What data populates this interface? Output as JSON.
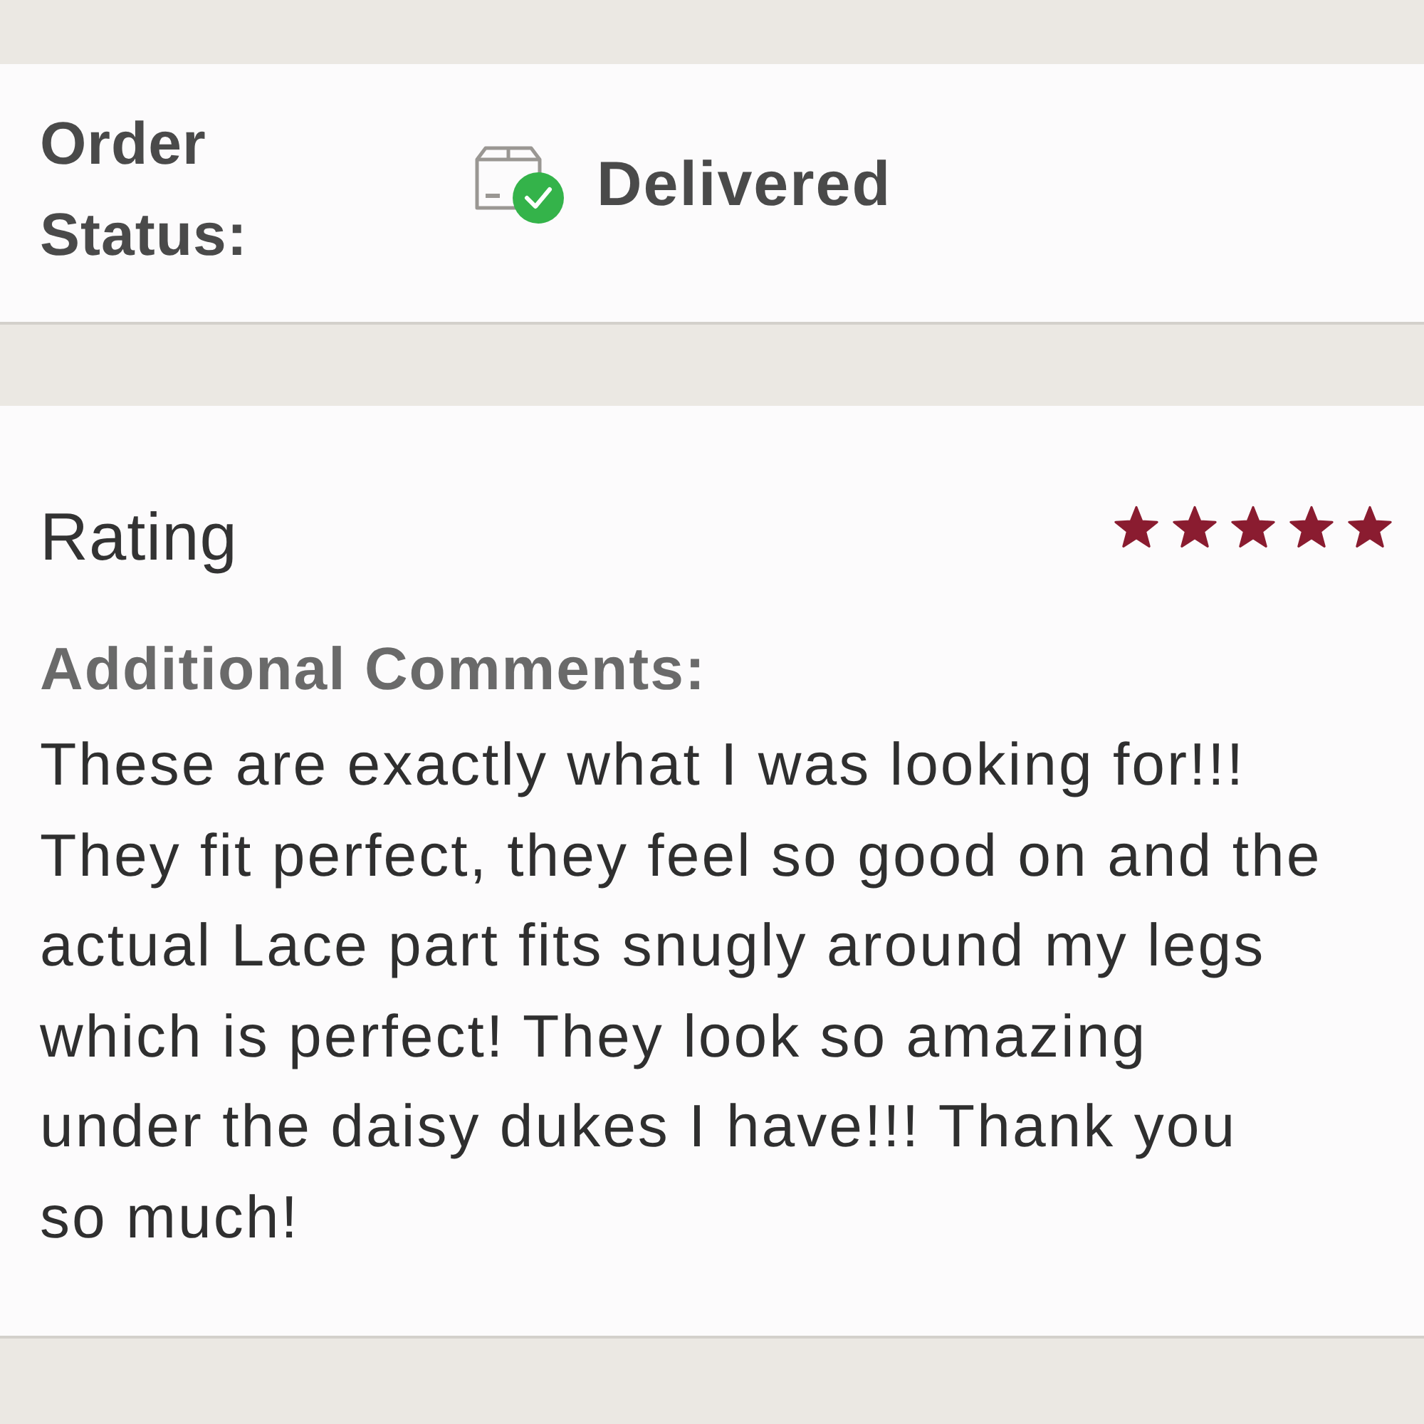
{
  "order_status": {
    "label": "Order Status:",
    "value": "Delivered"
  },
  "review": {
    "rating_label": "Rating",
    "stars": 5,
    "comments_label": "Additional Comments:",
    "comment": "These are exactly what I was looking for!!! They fit perfect, they feel so good on and the actual Lace part fits snugly around my legs which is perfect! They look so amazing under the daisy dukes I have!!! Thank you so much!"
  }
}
